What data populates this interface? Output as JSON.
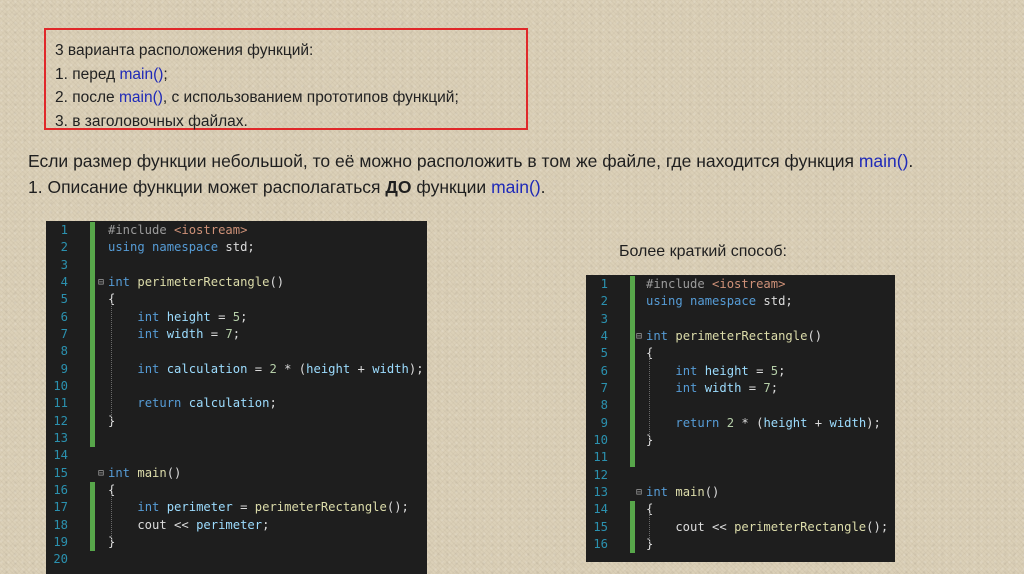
{
  "box": {
    "line1": "3 варианта расположения функций:",
    "line2_prefix": "1. перед ",
    "line2_main": "main()",
    "line2_suffix": ";",
    "line3_prefix": "2. после ",
    "line3_main": "main()",
    "line3_suffix": ", с использованием прототипов функций;",
    "line4": "3. в заголовочных файлах."
  },
  "paragraph": {
    "line1_text": "Если размер функции небольшой, то её можно расположить в том же файле, где находится функция ",
    "line1_main": "main()",
    "line1_end": ".",
    "line2_text": "1. Описание функции может располагаться ",
    "line2_bold": "ДО",
    "line2_text2": " функции ",
    "line2_main": "main()",
    "line2_end": "."
  },
  "caption": "Более краткий способ:",
  "code_left": {
    "lines": [
      [
        [
          "pp",
          "#include "
        ],
        [
          "str",
          "<iostream>"
        ]
      ],
      [
        [
          "kw",
          "using"
        ],
        [
          "",
          " "
        ],
        [
          "kw",
          "namespace"
        ],
        [
          "",
          " std;"
        ]
      ],
      [],
      [
        [
          "kw",
          "int"
        ],
        [
          "",
          " "
        ],
        [
          "fn",
          "perimeterRectangle"
        ],
        [
          "",
          "()"
        ]
      ],
      [
        [
          "",
          "{"
        ]
      ],
      [
        [
          "",
          "    "
        ],
        [
          "kw",
          "int"
        ],
        [
          "",
          " "
        ],
        [
          "var",
          "height"
        ],
        [
          "",
          " = "
        ],
        [
          "num",
          "5"
        ],
        [
          "",
          ";"
        ]
      ],
      [
        [
          "",
          "    "
        ],
        [
          "kw",
          "int"
        ],
        [
          "",
          " "
        ],
        [
          "var",
          "width"
        ],
        [
          "",
          " = "
        ],
        [
          "num",
          "7"
        ],
        [
          "",
          ";"
        ]
      ],
      [],
      [
        [
          "",
          "    "
        ],
        [
          "kw",
          "int"
        ],
        [
          "",
          " "
        ],
        [
          "var",
          "calculation"
        ],
        [
          "",
          " = "
        ],
        [
          "num",
          "2"
        ],
        [
          "",
          " * ("
        ],
        [
          "var",
          "height"
        ],
        [
          "",
          " + "
        ],
        [
          "var",
          "width"
        ],
        [
          "",
          ");"
        ]
      ],
      [],
      [
        [
          "",
          "    "
        ],
        [
          "kw",
          "return"
        ],
        [
          "",
          " "
        ],
        [
          "var",
          "calculation"
        ],
        [
          "",
          ";"
        ]
      ],
      [
        [
          "",
          "}"
        ]
      ],
      [],
      [],
      [
        [
          "kw",
          "int"
        ],
        [
          "",
          " "
        ],
        [
          "fn",
          "main"
        ],
        [
          "",
          "()"
        ]
      ],
      [
        [
          "",
          "{"
        ]
      ],
      [
        [
          "",
          "    "
        ],
        [
          "kw",
          "int"
        ],
        [
          "",
          " "
        ],
        [
          "var",
          "perimeter"
        ],
        [
          "",
          " = "
        ],
        [
          "fn",
          "perimeterRectangle"
        ],
        [
          "",
          "();"
        ]
      ],
      [
        [
          "",
          "    cout << "
        ],
        [
          "var",
          "perimeter"
        ],
        [
          "",
          ";"
        ]
      ],
      [
        [
          "",
          "}"
        ]
      ],
      []
    ],
    "numbers": [
      "1",
      "2",
      "3",
      "4",
      "5",
      "6",
      "7",
      "8",
      "9",
      "10",
      "11",
      "12",
      "13",
      "14",
      "15",
      "16",
      "17",
      "18",
      "19",
      "20"
    ]
  },
  "code_right": {
    "lines": [
      [
        [
          "pp",
          "#include "
        ],
        [
          "str",
          "<iostream>"
        ]
      ],
      [
        [
          "kw",
          "using"
        ],
        [
          "",
          " "
        ],
        [
          "kw",
          "namespace"
        ],
        [
          "",
          " std;"
        ]
      ],
      [],
      [
        [
          "kw",
          "int"
        ],
        [
          "",
          " "
        ],
        [
          "fn",
          "perimeterRectangle"
        ],
        [
          "",
          "()"
        ]
      ],
      [
        [
          "",
          "{"
        ]
      ],
      [
        [
          "",
          "    "
        ],
        [
          "kw",
          "int"
        ],
        [
          "",
          " "
        ],
        [
          "var",
          "height"
        ],
        [
          "",
          " = "
        ],
        [
          "num",
          "5"
        ],
        [
          "",
          ";"
        ]
      ],
      [
        [
          "",
          "    "
        ],
        [
          "kw",
          "int"
        ],
        [
          "",
          " "
        ],
        [
          "var",
          "width"
        ],
        [
          "",
          " = "
        ],
        [
          "num",
          "7"
        ],
        [
          "",
          ";"
        ]
      ],
      [],
      [
        [
          "",
          "    "
        ],
        [
          "kw",
          "return"
        ],
        [
          "",
          " "
        ],
        [
          "num",
          "2"
        ],
        [
          "",
          " * ("
        ],
        [
          "var",
          "height"
        ],
        [
          "",
          " + "
        ],
        [
          "var",
          "width"
        ],
        [
          "",
          ");"
        ]
      ],
      [
        [
          "",
          "}"
        ]
      ],
      [],
      [],
      [
        [
          "kw",
          "int"
        ],
        [
          "",
          " "
        ],
        [
          "fn",
          "main"
        ],
        [
          "",
          "()"
        ]
      ],
      [
        [
          "",
          "{"
        ]
      ],
      [
        [
          "",
          "    cout << "
        ],
        [
          "fn",
          "perimeterRectangle"
        ],
        [
          "",
          "();"
        ]
      ],
      [
        [
          "",
          "}"
        ]
      ]
    ],
    "numbers": [
      "1",
      "2",
      "3",
      "4",
      "5",
      "6",
      "7",
      "8",
      "9",
      "10",
      "11",
      "12",
      "13",
      "14",
      "15",
      "16"
    ]
  }
}
